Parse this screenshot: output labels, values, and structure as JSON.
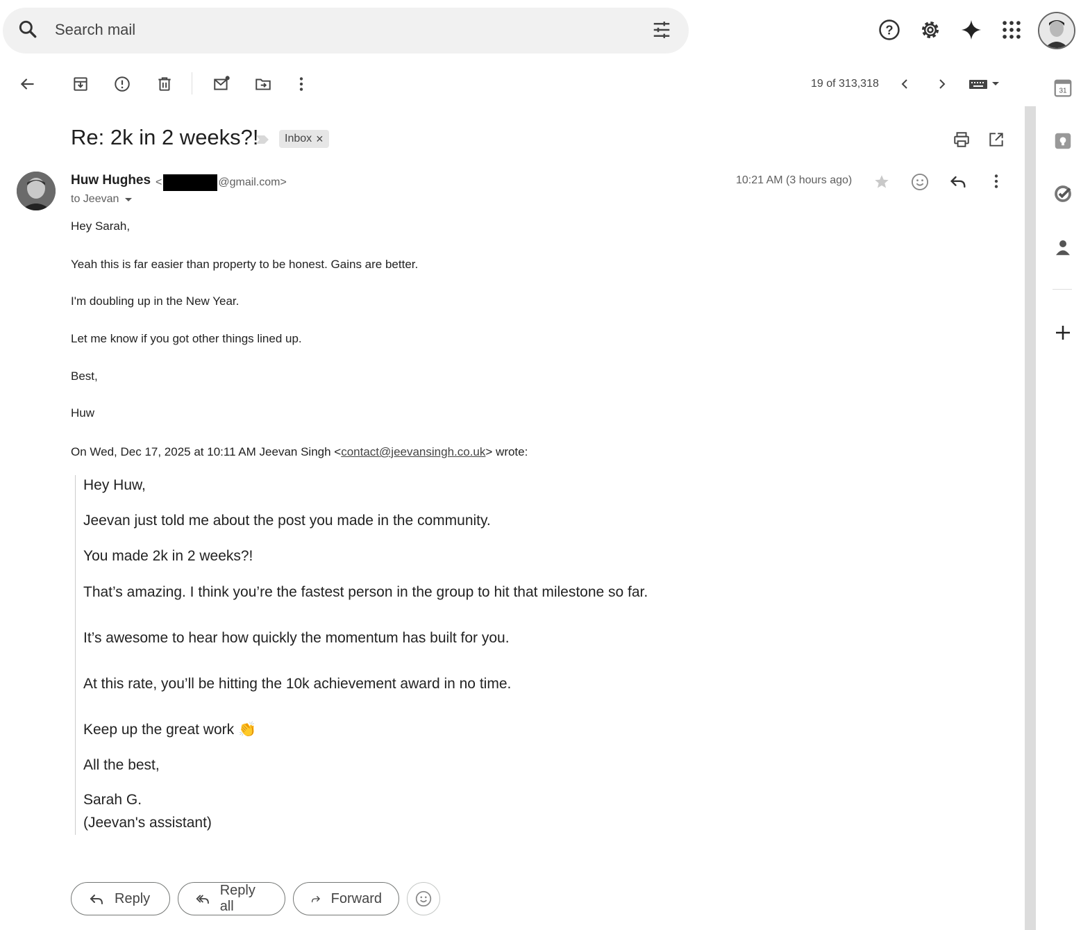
{
  "search": {
    "placeholder": "Search mail"
  },
  "toolbar": {
    "counter": "19 of 313,318"
  },
  "email": {
    "subject": "Re: 2k in 2 weeks?!",
    "label": "Inbox",
    "label_remove": "×",
    "sender_name": "Huw Hughes",
    "sender_email_prefix": "<",
    "sender_email_suffix": "@gmail.com>",
    "to_line": "to Jeevan",
    "timestamp": "10:21 AM (3 hours ago)"
  },
  "body": {
    "lines": [
      "Hey Sarah,",
      "Yeah this is far easier than property to be honest. Gains are better.",
      "I'm doubling up in the New Year.",
      "Let me know if you got other things lined up.",
      "Best,",
      "Huw"
    ],
    "quote_header_prefix": "On Wed, Dec 17, 2025 at 10:11 AM Jeevan Singh <",
    "quote_header_link": "contact@jeevansingh.co.uk",
    "quote_header_suffix": "> wrote:"
  },
  "quote": {
    "lines": [
      "Hey Huw,",
      "Jeevan just told me about the post you made in the community.",
      "You made 2k in 2 weeks?!",
      "That’s amazing. I think you’re the fastest person in the group to hit that milestone so far.",
      "It’s awesome to hear how quickly the momentum has built for you.",
      "At this rate, you’ll be hitting the 10k achievement award in no time.",
      "Keep up the great work 👏",
      "All the best,",
      "Sarah G.",
      "(Jeevan's assistant)"
    ]
  },
  "actions": {
    "reply": "Reply",
    "reply_all": "Reply all",
    "forward": "Forward"
  },
  "sidebar": {
    "calendar_day": "31"
  }
}
